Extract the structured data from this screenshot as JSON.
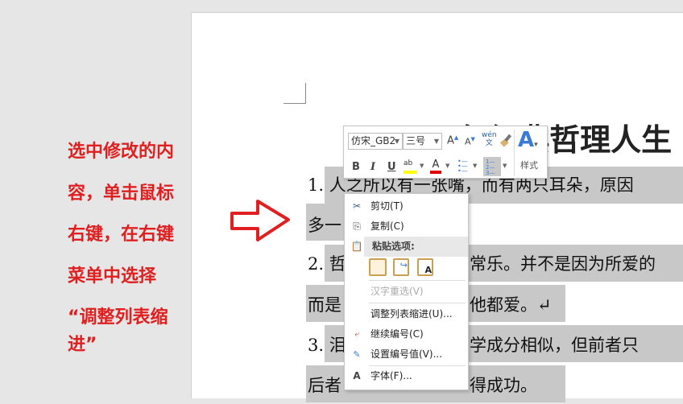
{
  "instruction": {
    "lines": [
      "选中修改的内",
      "容，单击鼠标",
      "右键，在右键",
      "菜单中选择",
      "“调整列表缩",
      "进”"
    ]
  },
  "document": {
    "title": "50 句经典哲理人生",
    "fragments": [
      "1. 人之所以有一张嘴，而有两只耳朵，原因",
      "多一",
      "2. 哲",
      "常乐。并不是因为所爱的",
      "而是",
      "他都爱。↵",
      "3. 泪",
      "学成分相似，但前者只",
      "后者",
      "得成功。"
    ]
  },
  "toolbar": {
    "font": "仿宋_GB2",
    "size": "三号",
    "bold": "B",
    "italic": "I",
    "underline": "U",
    "styles": "样式",
    "pinyin": "wén",
    "pinyin_char": "文",
    "colors": {
      "highlight": "#ffff00",
      "font": "#e00000"
    }
  },
  "menu": {
    "cut": "剪切(T)",
    "copy": "复制(C)",
    "paste_options": "粘贴选项:",
    "reconvert": "汉字重选(V)",
    "adjust_indent": "调整列表缩进(U)...",
    "continue_numbering": "继续编号(C)",
    "set_number": "设置编号值(V)...",
    "font": "字体(F)..."
  }
}
